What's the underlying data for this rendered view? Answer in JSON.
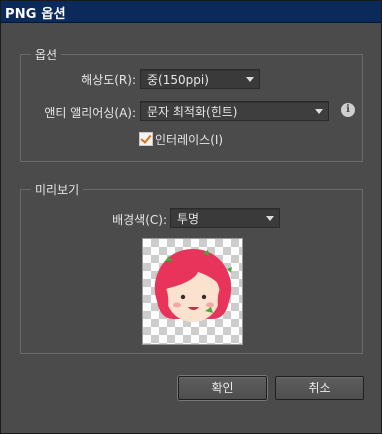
{
  "window": {
    "title": "PNG 옵션"
  },
  "options": {
    "legend": "옵션",
    "resolution": {
      "label": "해상도(R):",
      "value": "중(150ppi)"
    },
    "antialias": {
      "label": "앤티 앨리어싱(A):",
      "value": "문자 최적화(힌트)"
    },
    "info_icon": "info-icon",
    "interlace": {
      "label": "인터레이스(I)",
      "checked": true
    }
  },
  "preview": {
    "legend": "미리보기",
    "background": {
      "label": "배경색(C):",
      "value": "투명"
    }
  },
  "buttons": {
    "ok": "확인",
    "cancel": "취소"
  },
  "colors": {
    "title_bar": "#0b2a5a",
    "panel": "#4b4b4b",
    "checkmark": "#e07010",
    "hair": "#e8345a",
    "leaf": "#4aa83a"
  }
}
